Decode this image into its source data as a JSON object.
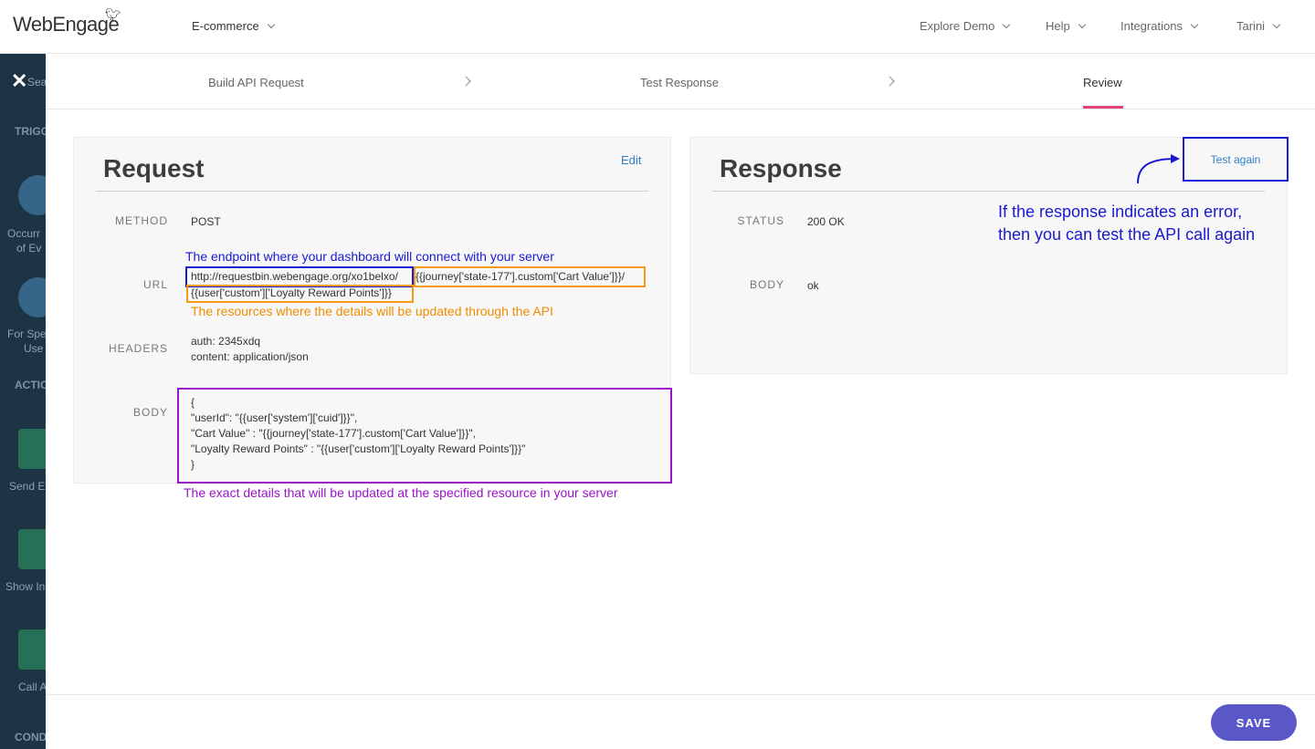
{
  "topbar": {
    "logo": "WebEngage",
    "project": "E-commerce",
    "nav": [
      "Explore Demo",
      "Help",
      "Integrations",
      "Tarini"
    ]
  },
  "sidebar": {
    "search_placeholder": "Sea",
    "trigger_heading": "TRIGG",
    "occurrence_line1": "Occurr",
    "occurrence_line2": "of Ev",
    "specific_line1": "For Spe",
    "specific_line2": "Use",
    "actions_heading": "ACTIO",
    "send_email": "Send E",
    "show_inapp": "Show In",
    "call_api": "Call A",
    "conditions_heading": "COND"
  },
  "steps": {
    "items": [
      "Build API Request",
      "Test Response",
      "Review"
    ],
    "active_index": 2
  },
  "request": {
    "title": "Request",
    "edit_label": "Edit",
    "method_label": "METHOD",
    "method_value": "POST",
    "url_label": "URL",
    "url_base": "http://requestbin.webengage.org/xo1belxo/",
    "url_part1": "{{journey['state-177'].custom['Cart Value']}}/",
    "url_part2": "{{user['custom']['Loyalty Reward Points']}}",
    "headers_label": "HEADERS",
    "headers": [
      "auth: 2345xdq",
      "content: application/json"
    ],
    "body_label": "BODY",
    "body_lines": [
      "{",
      "\"userId\": \"{{user['system']['cuid']}}\",",
      "\"Cart Value\" : \"{{journey['state-177'].custom['Cart Value']}}\",",
      "\"Loyalty Reward Points\" : \"{{user['custom']['Loyalty Reward Points']}}\"",
      "}"
    ]
  },
  "response": {
    "title": "Response",
    "test_again_label": "Test again",
    "status_label": "STATUS",
    "status_value": "200 OK",
    "body_label": "BODY",
    "body_value": "ok"
  },
  "annotations": {
    "endpoint": "The endpoint where your dashboard will connect with your server",
    "resources": "The resources where the details will be updated through the API",
    "details": "The exact details that will be updated at the specified resource in your server",
    "error_line1": "If the response indicates an error,",
    "error_line2": "then you can test the API call again"
  },
  "colors": {
    "annotation_blue": "#1a1ad0",
    "annotation_orange": "#f39c12",
    "annotation_purple": "#9a12c9",
    "save_button": "#5a57c9",
    "active_step_underline": "#e0457b",
    "link": "#2f80c6",
    "sidebar_bg": "#1d3445"
  },
  "footer": {
    "save_label": "SAVE"
  }
}
